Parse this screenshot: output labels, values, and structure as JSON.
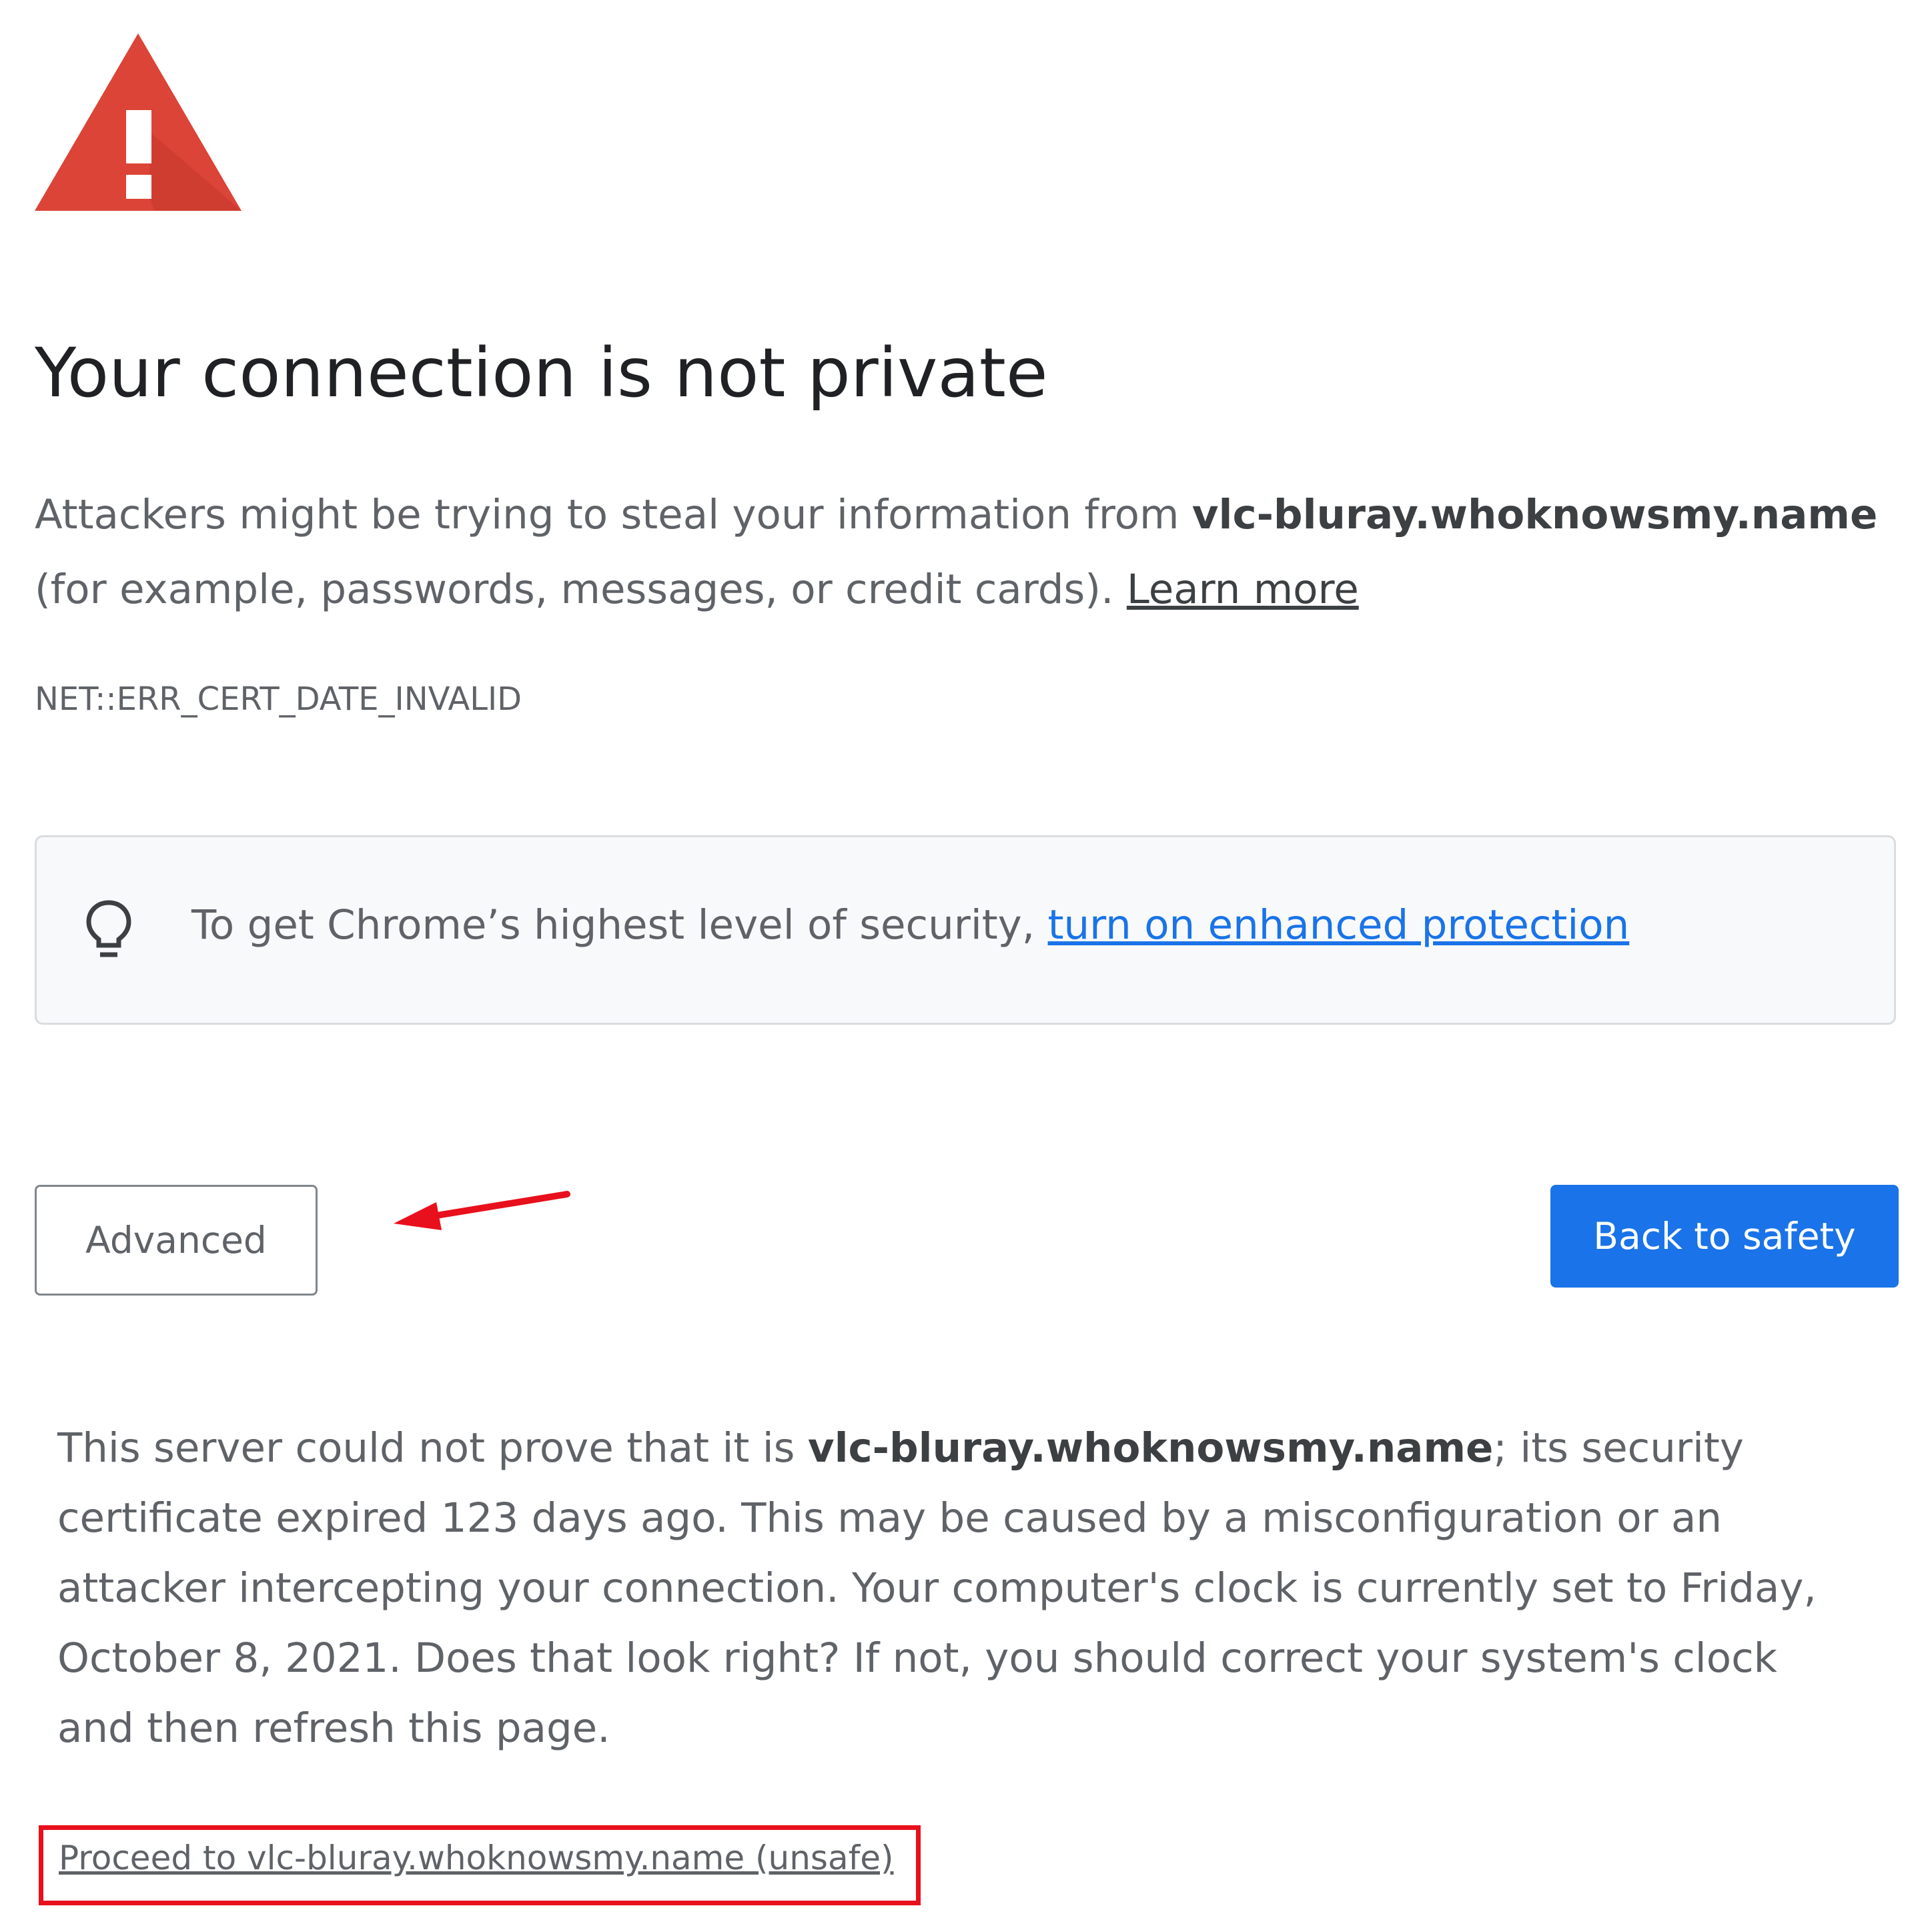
{
  "heading": "Your connection is not private",
  "intro": {
    "text_before": "Attackers might be trying to steal your information from ",
    "domain": "vlc-bluray.whoknowsmy.name",
    "text_after": " (for example, passwords, messages, or credit cards). ",
    "learn_more_label": "Learn more"
  },
  "error_code": "NET::ERR_CERT_DATE_INVALID",
  "enhanced_protection": {
    "text": "To get Chrome’s highest level of security, ",
    "link_label": "turn on enhanced protection"
  },
  "buttons": {
    "advanced_label": "Advanced",
    "back_label": "Back to safety"
  },
  "details": {
    "text_before": "This server could not prove that it is ",
    "domain": "vlc-bluray.whoknowsmy.name",
    "text_after": "; its security certificate expired 123 days ago. This may be caused by a misconfiguration or an attacker intercepting your connection. Your computer's clock is currently set to Friday, October 8, 2021. Does that look right? If not, you should correct your system's clock and then refresh this page."
  },
  "proceed_link_label": "Proceed to vlc-bluray.whoknowsmy.name (unsafe)",
  "colors": {
    "warning_red": "#db4437",
    "primary_blue": "#1a73e8",
    "annotation_red": "#e8101c"
  },
  "icons": {
    "warning": "warning-triangle-icon",
    "tip": "lightbulb-icon"
  }
}
